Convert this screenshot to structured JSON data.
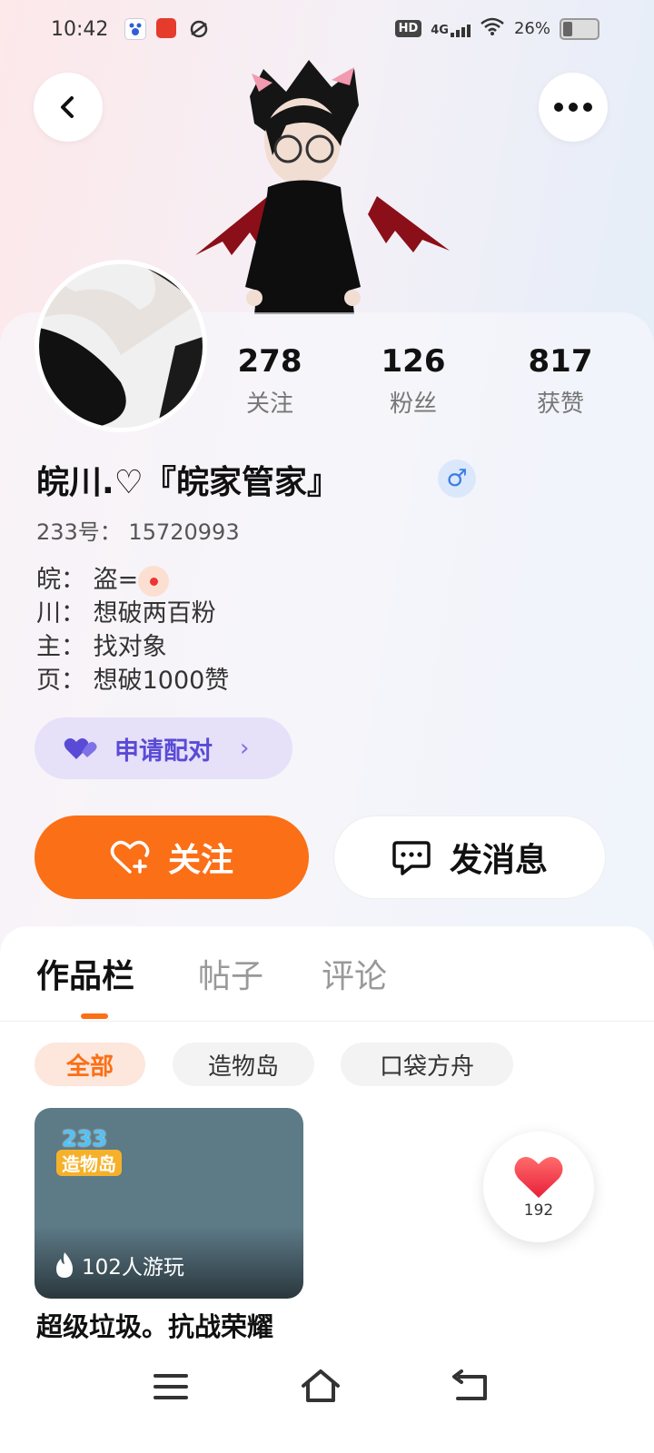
{
  "status_bar": {
    "time": "10:42",
    "network_badge": "HD",
    "network_type": "4G",
    "battery_percent": "26%",
    "icons": [
      "baidu-icon",
      "app-icon",
      "browser-icon",
      "signal-icon",
      "wifi-icon",
      "battery-icon"
    ]
  },
  "header": {
    "back_icon": "chevron-left-icon",
    "more_icon": "more-dots-icon"
  },
  "profile": {
    "stats": [
      {
        "value": "278",
        "label": "关注"
      },
      {
        "value": "126",
        "label": "粉丝"
      },
      {
        "value": "817",
        "label": "获赞"
      }
    ],
    "nickname": "皖川.♡『皖家管家』",
    "gender_symbol": "♂",
    "uid": "233号： 15720993",
    "bio": [
      {
        "prefix": "皖：",
        "text": "盗="
      },
      {
        "prefix": "川：",
        "text": "想破两百粉"
      },
      {
        "prefix": "主：",
        "text": "找对象"
      },
      {
        "prefix": "页：",
        "text": "想破1000赞"
      }
    ],
    "pair_button": "申请配对",
    "follow_button": "关注",
    "message_button": "发消息"
  },
  "tabs": [
    {
      "label": "作品栏",
      "active": true
    },
    {
      "label": "帖子",
      "active": false
    },
    {
      "label": "评论",
      "active": false
    }
  ],
  "filters": [
    {
      "label": "全部",
      "active": true
    },
    {
      "label": "造物岛",
      "active": false
    },
    {
      "label": "口袋方舟",
      "active": false
    }
  ],
  "works": [
    {
      "logo_number": "233",
      "logo_text": "造物岛",
      "plays": "102人游玩",
      "title": "超级垃圾。抗战荣耀"
    }
  ],
  "like_widget": {
    "count": "192"
  },
  "colors": {
    "accent": "#fb6f16",
    "pair_text": "#5a4bd6",
    "pair_bg": "#e6e1f8",
    "gender": "#3b7de6"
  }
}
